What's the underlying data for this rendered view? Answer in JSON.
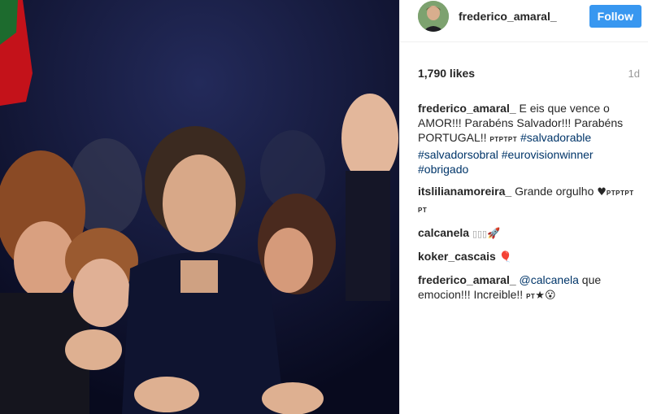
{
  "post": {
    "photo_alt": "",
    "author": {
      "username": "frederico_amaral_",
      "follow_label": "Follow"
    },
    "likes": "1,790 likes",
    "time_ago": "1d",
    "caption": {
      "user": "frederico_amaral_",
      "text": "E eis que vence o AMOR!!! Parabéns Salvador!!! Parabéns PORTUGAL!!",
      "flags": "PTPTPT",
      "hashtags": [
        "#salvadorable",
        "#salvadorsobral",
        "#eurovisionwinner",
        "#obrigado"
      ]
    },
    "comments": [
      {
        "user": "itslilianamoreira_",
        "text": "Grande orgulho",
        "emoji": "♥",
        "flags": "PTPTPT PT"
      },
      {
        "user": "calcanela",
        "boxes": "▯▯▯",
        "emoji": "🚀"
      },
      {
        "user": "koker_cascais",
        "emoji": "🎈"
      },
      {
        "user": "frederico_amaral_",
        "mention": "@calcanela",
        "text": "que emocion!!! Increible!!",
        "flags": "PT",
        "emoji2": "★😮"
      }
    ]
  },
  "colors": {
    "follow": "#3897f0",
    "link": "#003569",
    "text": "#262626",
    "muted": "#999999"
  }
}
